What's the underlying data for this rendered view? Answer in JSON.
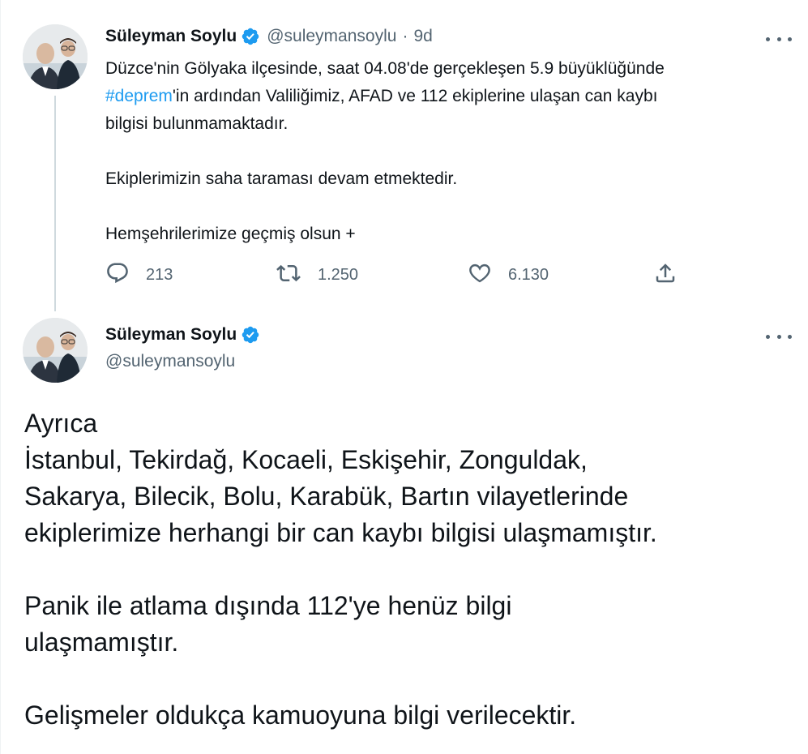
{
  "tweet1": {
    "author_name": "Süleyman Soylu",
    "handle": "@suleymansoylu",
    "separator": "·",
    "time": "9d",
    "text_line1": "Düzce'nin Gölyaka ilçesinde, saat 04.08'de gerçekleşen 5.9 büyüklüğünde",
    "hashtag": "#deprem",
    "text_line2_rest": "'in ardından Valiliğimiz, AFAD ve 112 ekiplerine ulaşan can kaybı",
    "text_line3": "bilgisi bulunmamaktadır.",
    "text_para2": "Ekiplerimizin saha taraması devam etmektedir.",
    "text_para3": "Hemşehrilerimize geçmiş olsun +",
    "reply_count": "213",
    "retweet_count": "1.250",
    "like_count": "6.130"
  },
  "tweet2": {
    "author_name": "Süleyman Soylu",
    "handle": "@suleymansoylu",
    "line1": "Ayrıca",
    "line2": "İstanbul, Tekirdağ, Kocaeli, Eskişehir, Zonguldak,",
    "line3": "Sakarya, Bilecik, Bolu, Karabük, Bartın vilayetlerinde",
    "line4": "ekiplerimize herhangi bir can kaybı bilgisi ulaşmamıştır.",
    "line5": "Panik ile atlama dışında 112'ye henüz bilgi",
    "line6": "ulaşmamıştır.",
    "line7": "Gelişmeler oldukça kamuoyuna bilgi verilecektir."
  },
  "icons": {
    "verified": "verified-badge-icon",
    "more": "more-options-icon",
    "reply": "reply-icon",
    "retweet": "retweet-icon",
    "like": "heart-icon",
    "share": "share-icon"
  },
  "colors": {
    "accent": "#1d9bf0",
    "text": "#0f1419",
    "secondary": "#536471",
    "thread_line": "#cfd9de"
  }
}
